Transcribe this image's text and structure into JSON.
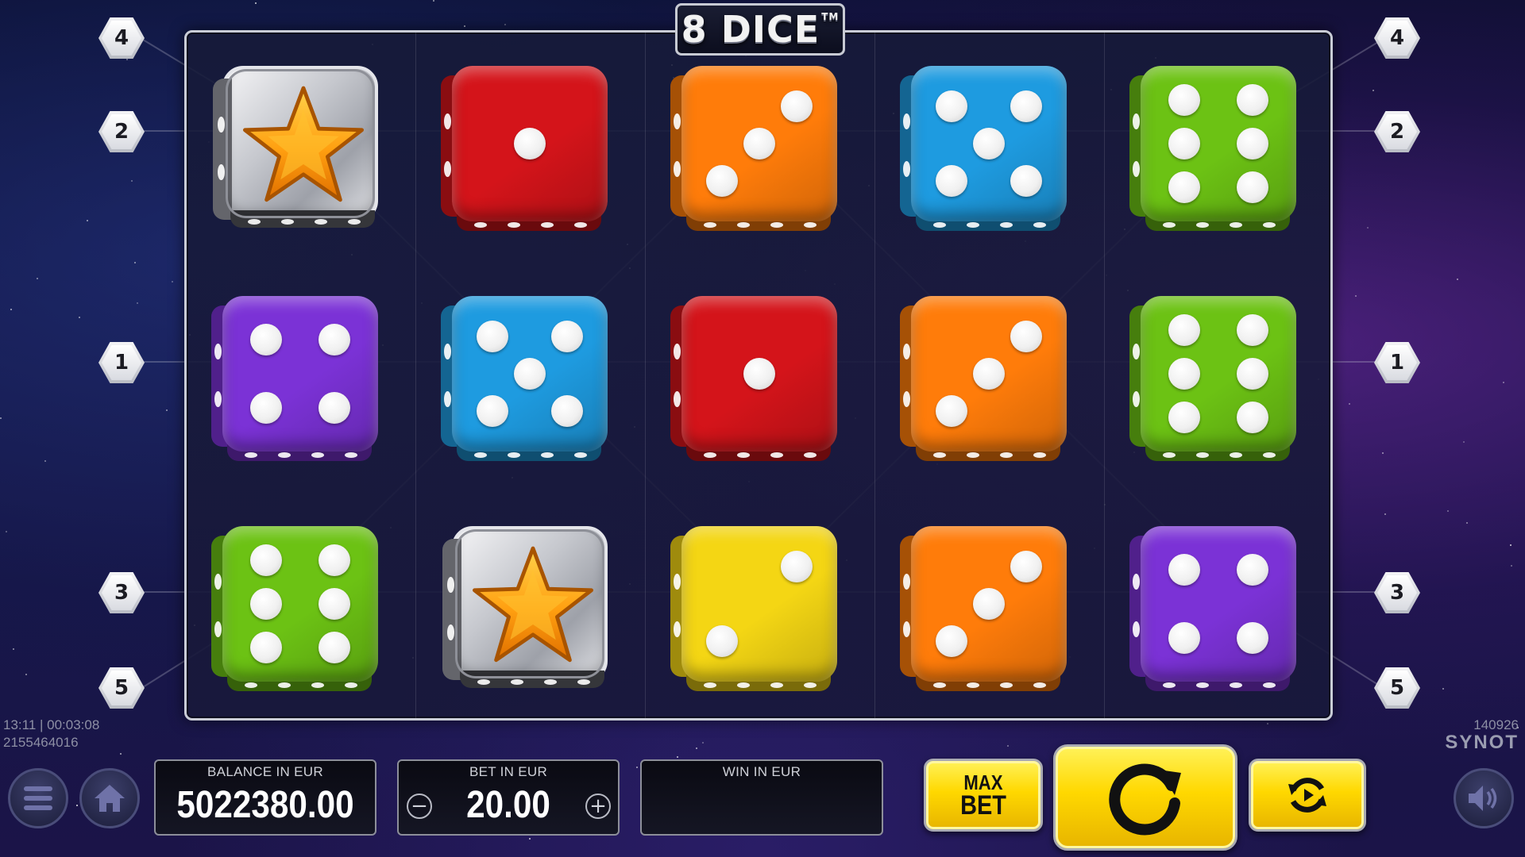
{
  "game": {
    "logo": "8 DICE",
    "trademark": "TM"
  },
  "paylines": {
    "left": [
      "4",
      "2",
      "1",
      "3",
      "5"
    ],
    "right": [
      "4",
      "2",
      "1",
      "3",
      "5"
    ]
  },
  "reels": [
    [
      "star",
      "purple-4",
      "green-6"
    ],
    [
      "red-1",
      "blue-5",
      "star"
    ],
    [
      "orange-3",
      "red-1",
      "yellow-2"
    ],
    [
      "blue-5",
      "orange-3",
      "orange-3"
    ],
    [
      "green-6",
      "green-6",
      "purple-4"
    ]
  ],
  "colors": {
    "red": "#d4141a",
    "orange": "#ff7c0a",
    "blue": "#1e9be0",
    "green": "#6cc214",
    "purple": "#7b32d6",
    "yellow": "#f4d614",
    "button_yellow": "#ffd800"
  },
  "session": {
    "time": "13:11 | 00:03:08",
    "session_id": "2155464016",
    "build": "140926",
    "brand": "SYNOT"
  },
  "balance": {
    "label": "BALANCE IN EUR",
    "value": "5022380.00"
  },
  "bet": {
    "label": "BET IN EUR",
    "value": "20.00",
    "minus": "−",
    "plus": "+"
  },
  "win": {
    "label": "WIN IN EUR",
    "value": ""
  },
  "buttons": {
    "max_bet_line1": "MAX",
    "max_bet_line2": "BET",
    "menu_icon": "hamburger-menu-icon",
    "home_icon": "home-icon",
    "spin_icon": "circular-arrow-icon",
    "autoplay_icon": "autoplay-cycle-icon",
    "sound_icon": "speaker-icon"
  }
}
